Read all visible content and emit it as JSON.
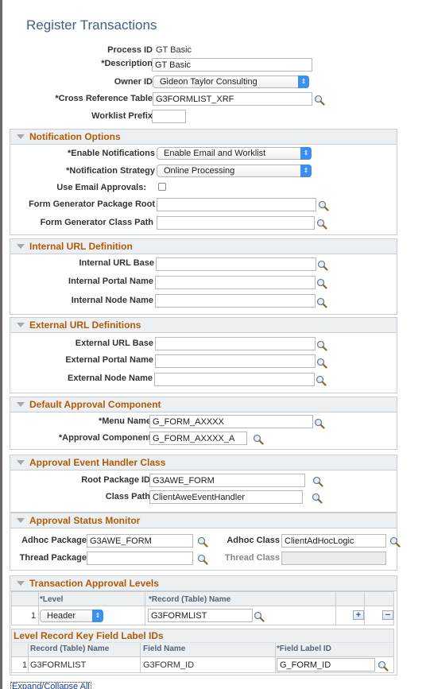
{
  "page": {
    "title": "Register Transactions"
  },
  "header_fields": {
    "process_id_label": "Process ID",
    "process_id_value": "GT Basic",
    "description_label": "*Description",
    "description_value": "GT Basic",
    "owner_label": "Owner ID",
    "owner_value": "Gideon Taylor Consulting",
    "xref_label": "*Cross Reference Table",
    "xref_value": "G3FORMLIST_XRF",
    "worklist_label": "Worklist Prefix",
    "worklist_value": ""
  },
  "notification": {
    "title": "Notification Options",
    "enable_label": "*Enable Notifications",
    "enable_value": "Enable Email and Worklist",
    "strategy_label": "*Notification Strategy",
    "strategy_value": "Online Processing",
    "email_approvals_label": "Use Email Approvals:",
    "email_approvals_checked": false,
    "pkg_root_label": "Form Generator Package Root",
    "pkg_root_value": "",
    "class_path_label": "Form Generator Class Path",
    "class_path_value": ""
  },
  "internal_url": {
    "title": "Internal URL Definition",
    "base_label": "Internal URL Base",
    "base_value": "",
    "portal_label": "Internal Portal Name",
    "portal_value": "",
    "node_label": "Internal Node Name",
    "node_value": ""
  },
  "external_url": {
    "title": "External URL Definitions",
    "base_label": "External URL Base",
    "base_value": "",
    "portal_label": "External Portal Name",
    "portal_value": "",
    "node_label": "External Node Name",
    "node_value": ""
  },
  "approval_component": {
    "title": "Default Approval Component",
    "menu_label": "*Menu Name",
    "menu_value": "G_FORM_AXXXX",
    "component_label": "*Approval Component",
    "component_value": "G_FORM_AXXXX_A"
  },
  "event_handler": {
    "title": "Approval Event Handler Class",
    "root_label": "Root Package ID",
    "root_value": "G3AWE_FORM",
    "path_label": "Class Path",
    "path_value": "ClientAweEventHandler"
  },
  "status_monitor": {
    "title": "Approval Status Monitor",
    "adhoc_pkg_label": "Adhoc Package",
    "adhoc_pkg_value": "G3AWE_FORM",
    "adhoc_class_label": "Adhoc Class",
    "adhoc_class_value": "ClientAdHocLogic",
    "thread_pkg_label": "Thread Package",
    "thread_pkg_value": "",
    "thread_class_label": "Thread Class",
    "thread_class_value": ""
  },
  "levels": {
    "title": "Transaction Approval Levels",
    "col_level": "*Level",
    "col_record": "*Record (Table) Name",
    "rows": [
      {
        "num": "1",
        "level": "Header",
        "record": "G3FORMLIST"
      }
    ],
    "add_label": "+",
    "remove_label": "−"
  },
  "key_fields": {
    "title": "Level Record Key Field Label IDs",
    "col_record": "Record (Table) Name",
    "col_field": "Field Name",
    "col_label": "*Field Label ID",
    "rows": [
      {
        "num": "1",
        "record": "G3FORMLIST",
        "field": "G3FORM_ID",
        "label_id": "G_FORM_ID"
      }
    ]
  },
  "footer": {
    "expand_collapse": "Expand/Collapse All"
  },
  "icons": {
    "lookup": "magnifier-icon",
    "select": "updown-arrow-icon",
    "collapse": "triangle-down-icon"
  },
  "colors": {
    "section_title": "#b35a06",
    "page_title": "#3f5f8c",
    "select_accent": "#3d8ef2"
  }
}
